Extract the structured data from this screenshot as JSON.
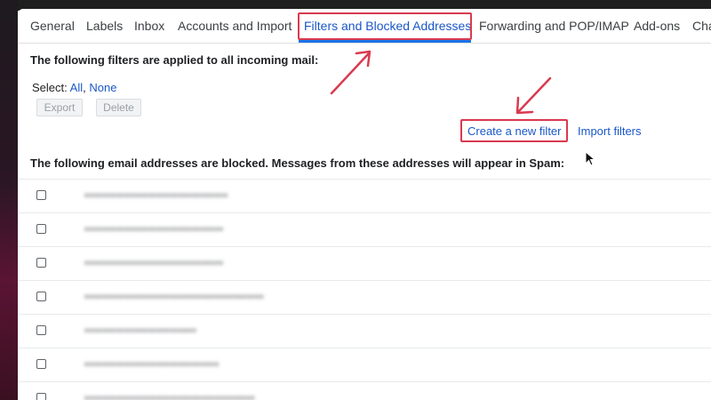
{
  "tabs": [
    {
      "label": "General",
      "active": false
    },
    {
      "label": "Labels",
      "active": false
    },
    {
      "label": "Inbox",
      "active": false
    },
    {
      "label": "Accounts and Import",
      "active": false
    },
    {
      "label": "Filters and Blocked Addresses",
      "active": true
    },
    {
      "label": "Forwarding and POP/IMAP",
      "active": false
    },
    {
      "label": "Add-ons",
      "active": false
    },
    {
      "label": "Cha",
      "active": false
    }
  ],
  "filters": {
    "heading": "The following filters are applied to all incoming mail:",
    "select_label": "Select:",
    "select_all": "All",
    "select_separator": ",",
    "select_none": "None",
    "export_label": "Export",
    "delete_label": "Delete",
    "create_filter_label": "Create a new filter",
    "import_filters_label": "Import filters"
  },
  "blocked": {
    "heading": "The following email addresses are blocked. Messages from these addresses will appear in Spam:",
    "addresses": [
      "••••••••••••••••••••••••••••••••",
      "•••••••••••••••••••••••••••••••",
      "•••••••••••••••••••••••••••••••",
      "••••••••••••••••••••••••••••••••••••••••",
      "•••••••••••••••••••••••••",
      "••••••••••••••••••••••••••••••",
      "••••••••••••••••••••••••••••••••••••••"
    ]
  },
  "colors": {
    "annotation": "#d93a4f",
    "link": "#1a57c7",
    "active_underline": "#1a73e8"
  }
}
